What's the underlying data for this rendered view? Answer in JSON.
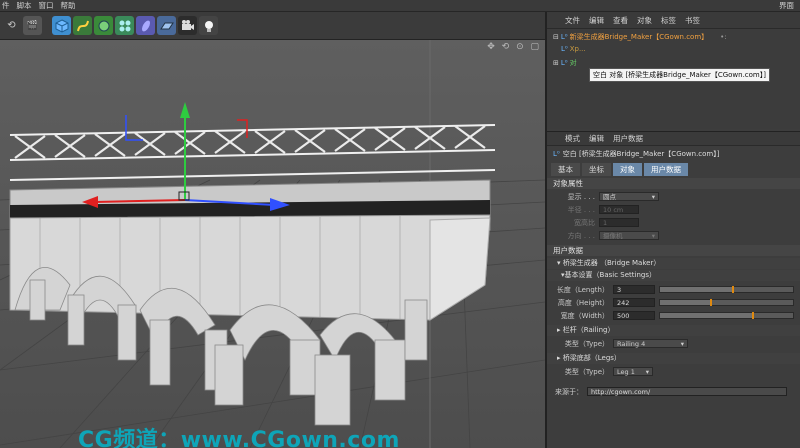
{
  "menubar": {
    "items": [
      "件",
      "脚本",
      "窗口",
      "帮助"
    ],
    "right_label": "界面"
  },
  "toolbar": {
    "icons": [
      "cube-icon",
      "spline-icon",
      "nurbs-icon",
      "array-icon",
      "deformer-icon",
      "floor-icon",
      "camera-icon",
      "light-icon"
    ]
  },
  "object_manager": {
    "menu": [
      "文件",
      "编辑",
      "查看",
      "对象",
      "标签",
      "书签"
    ],
    "rows": [
      {
        "label": "新梁生成器Bridge_Maker【CGown.com】",
        "color": "#f0a040"
      },
      {
        "label": "Xp...",
        "color": "#c89a40"
      },
      {
        "label": "对",
        "color": "#66cc66"
      }
    ],
    "tooltip": "空白 对象 [桥梁生成器Bridge_Maker【CGown.com】]"
  },
  "attribute_manager": {
    "menu": [
      "模式",
      "编辑",
      "用户数据"
    ],
    "title": "空白 [桥梁生成器Bridge_Maker【CGown.com】]",
    "tabs": [
      {
        "label": "基本",
        "active": false
      },
      {
        "label": "坐标",
        "active": false
      },
      {
        "label": "对象",
        "active": true
      },
      {
        "label": "用户数据",
        "active": true
      }
    ],
    "object_props": {
      "header": "对象属性",
      "display_label": "显示 . . .",
      "display_value": "圆点",
      "radius_label": "半径 . . .",
      "radius_value": "10 cm",
      "aspect_label": "宽高比",
      "aspect_value": "1",
      "orientation_label": "方向 . . .",
      "orientation_value": "摄像机"
    },
    "user_data": {
      "header": "用户数据",
      "group": "▾ 桥梁生成器 （Bridge Maker）",
      "basic": "▾基本设置（Basic Settings）",
      "length_label": "长度（Length）",
      "length_value": "3",
      "length_fraction": 0.55,
      "height_label": "高度（Height）",
      "height_value": "242",
      "height_fraction": 0.38,
      "width_label": "宽度（Width）",
      "width_value": "500",
      "width_fraction": 0.7,
      "railing_section": "▸ 栏杆（Railing）",
      "railing_type_label": "类型（Type）",
      "railing_type_value": "Railing 4",
      "legs_section": "▸ 桥梁底部（Legs）",
      "legs_type_label": "类型（Type）",
      "legs_type_value": "Leg 1",
      "source_label": "来源于：",
      "source_value": "http://cgown.com/"
    }
  },
  "viewport": {
    "nav_icons": "✥ ⟲ ⊙ ▢",
    "watermark": "CG频道：www.CGown.com"
  }
}
